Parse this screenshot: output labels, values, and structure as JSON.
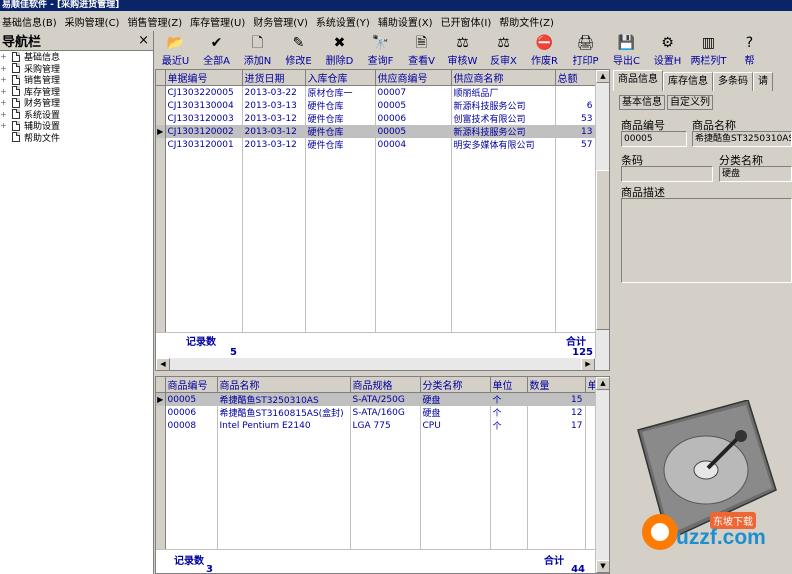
{
  "window": {
    "title": "易顺佳软件 - [采购进货管理]"
  },
  "menu": [
    "基础信息(B)",
    "采购管理(C)",
    "销售管理(Z)",
    "库存管理(U)",
    "财务管理(V)",
    "系统设置(Y)",
    "辅助设置(X)",
    "已开窗体(I)",
    "帮助文件(Z)"
  ],
  "sidebar": {
    "title": "导航栏",
    "close": "×",
    "items": [
      {
        "label": "基础信息",
        "expander": "+"
      },
      {
        "label": "采购管理",
        "expander": "+"
      },
      {
        "label": "销售管理",
        "expander": "+"
      },
      {
        "label": "库存管理",
        "expander": "+"
      },
      {
        "label": "财务管理",
        "expander": "+"
      },
      {
        "label": "系统设置",
        "expander": "+"
      },
      {
        "label": "辅助设置",
        "expander": "+"
      },
      {
        "label": "帮助文件",
        "expander": ""
      }
    ]
  },
  "toolbar": [
    {
      "label": "最近U",
      "icon": "folder-open-icon",
      "glyph": "📂"
    },
    {
      "label": "全部A",
      "icon": "checkmark-icon",
      "glyph": "✔"
    },
    {
      "label": "添加N",
      "icon": "add-doc-icon",
      "glyph": "🗋"
    },
    {
      "label": "修改E",
      "icon": "edit-icon",
      "glyph": "✎"
    },
    {
      "label": "删除D",
      "icon": "delete-icon",
      "glyph": "✖"
    },
    {
      "label": "查询F",
      "icon": "binoculars-icon",
      "glyph": "🔭"
    },
    {
      "label": "查看V",
      "icon": "view-icon",
      "glyph": "🗎"
    },
    {
      "label": "审核W",
      "icon": "approve-icon",
      "glyph": "⚖"
    },
    {
      "label": "反审X",
      "icon": "unapprove-icon",
      "glyph": "⚖"
    },
    {
      "label": "作废R",
      "icon": "void-icon",
      "glyph": "⛔"
    },
    {
      "label": "打印P",
      "icon": "print-icon",
      "glyph": "🖨"
    },
    {
      "label": "导出C",
      "icon": "save-icon",
      "glyph": "💾"
    },
    {
      "label": "设置H",
      "icon": "settings-icon",
      "glyph": "⚙"
    },
    {
      "label": "两栏列T",
      "icon": "columns-icon",
      "glyph": "▥"
    },
    {
      "label": "帮",
      "icon": "help-icon",
      "glyph": "?"
    }
  ],
  "orders": {
    "columns": [
      "单据编号",
      "进货日期",
      "入库仓库",
      "供应商编号",
      "供应商名称",
      "总额"
    ],
    "rows": [
      [
        "CJ1303220005",
        "2013-03-22",
        "原材仓库一",
        "00007",
        "顺丽纸品厂",
        ""
      ],
      [
        "CJ1303130004",
        "2013-03-13",
        "硬件仓库",
        "00005",
        "新源科技服务公司",
        "6"
      ],
      [
        "CJ1303120003",
        "2013-03-12",
        "硬件仓库",
        "00006",
        "创富技术有限公司",
        "53"
      ],
      [
        "CJ1303120002",
        "2013-03-12",
        "硬件仓库",
        "00005",
        "新源科技服务公司",
        "13"
      ],
      [
        "CJ1303120001",
        "2013-03-12",
        "硬件仓库",
        "00004",
        "明安多媒体有限公司",
        "57"
      ]
    ],
    "selected_row": 3,
    "footer": {
      "count_label": "记录数",
      "count": "5",
      "total_label": "合计",
      "total": "125"
    }
  },
  "items": {
    "columns": [
      "商品编号",
      "商品名称",
      "商品规格",
      "分类名称",
      "单位",
      "数量",
      "单"
    ],
    "rows": [
      [
        "00005",
        "希捷酷鱼ST3250310AS",
        "S-ATA/250G",
        "硬盘",
        "个",
        "15"
      ],
      [
        "00006",
        "希捷酷鱼ST3160815AS(盒封)",
        "S-ATA/160G",
        "硬盘",
        "个",
        "12"
      ],
      [
        "00008",
        "Intel Pentium E2140",
        "LGA 775",
        "CPU",
        "个",
        "17"
      ]
    ],
    "selected_row": 0,
    "footer": {
      "count_label": "记录数",
      "count": "3",
      "total_label": "合计",
      "total": "44"
    }
  },
  "detail": {
    "tabs": [
      "商品信息",
      "库存信息",
      "多条码",
      "请"
    ],
    "subtabs": [
      "基本信息",
      "自定义列"
    ],
    "code_label": "商品编号",
    "name_label": "商品名称",
    "code": "00005",
    "name": "希捷酷鱼ST3250310AS",
    "barcode_label": "条码",
    "category_label": "分类名称",
    "barcode": "",
    "category": "硬盘",
    "desc_label": "商品描述"
  },
  "watermark": {
    "text": "uzzf.com",
    "badge": "东坡下载"
  }
}
